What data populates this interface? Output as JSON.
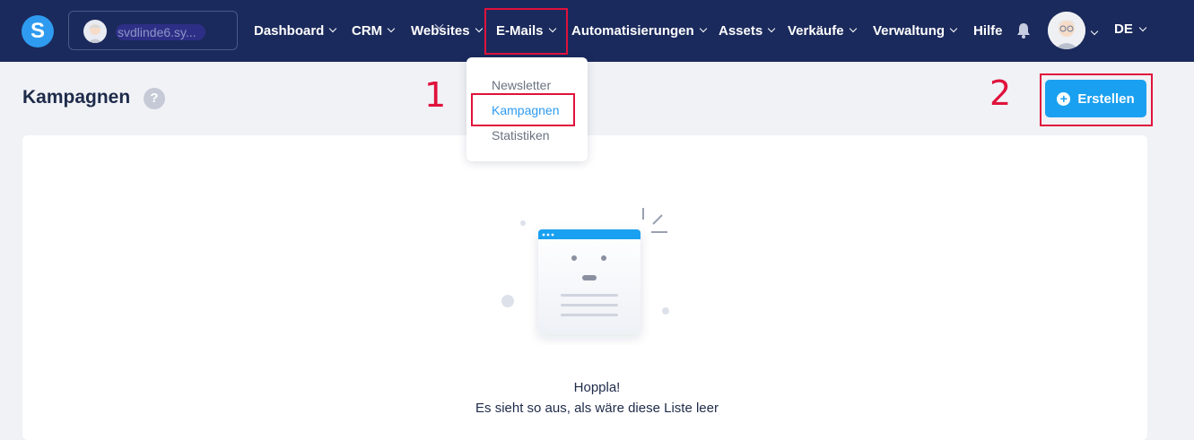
{
  "nav": {
    "account_name": "svdlinde6.sy...",
    "items": [
      {
        "label": "Dashboard"
      },
      {
        "label": "CRM"
      },
      {
        "label": "Websites"
      },
      {
        "label": "E-Mails"
      },
      {
        "label": "Automatisierungen"
      },
      {
        "label": "Assets"
      },
      {
        "label": "Verkäufe"
      },
      {
        "label": "Verwaltung"
      }
    ],
    "help": "Hilfe",
    "language": "DE"
  },
  "dropdown": {
    "items": [
      "Newsletter",
      "Kampagnen",
      "Statistiken"
    ],
    "active": "Kampagnen"
  },
  "page": {
    "title": "Kampagnen",
    "help_icon": "?",
    "create_button": "Erstellen"
  },
  "empty_state": {
    "line1": "Hoppla!",
    "line2": "Es sieht so aus, als wäre diese Liste leer"
  },
  "annotations": {
    "step1": "1",
    "step2": "2"
  },
  "colors": {
    "topbar": "#1b2a5c",
    "accent": "#1aa0f0",
    "highlight": "#e0123c"
  }
}
